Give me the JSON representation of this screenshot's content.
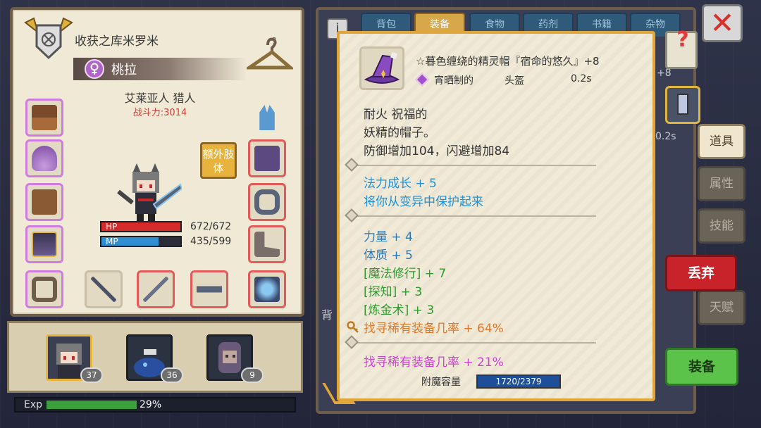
{
  "character": {
    "guild_name": "收获之库米罗米",
    "name": "桃拉",
    "race_class": "艾莱亚人 猎人",
    "combat_power": "战斗力:3014",
    "extra_limb_label": "额外肢体",
    "hp_label": "HP",
    "hp_value": "672/672",
    "mp_label": "MP",
    "mp_value": "435/599",
    "hp_fraction": 1.0,
    "mp_fraction": 0.726
  },
  "party": [
    {
      "level": "37"
    },
    {
      "level": "36"
    },
    {
      "level": "9"
    }
  ],
  "exp": {
    "label": "Exp",
    "percent_text": "29%",
    "fraction": 0.29
  },
  "inventory": {
    "info_label": "i",
    "tabs": [
      "背包",
      "装备",
      "食物",
      "药剂",
      "书籍",
      "杂物"
    ],
    "active_tab": "装备",
    "side_tabs": [
      "道具",
      "属性",
      "技能",
      "",
      "天赋"
    ],
    "discard_label": "丢弃",
    "equip_label": "装备",
    "close_glyph": "✕",
    "help_glyph": "?",
    "partial_label": "背",
    "partial_number": "+8",
    "partial_time": "0.2s"
  },
  "tooltip": {
    "title": "☆暮色缠绕的精灵帽『宿命的悠久』+8",
    "material": "宵晒制的",
    "slot": "头盔",
    "speed": "0.2s",
    "desc_line1": "耐火 祝福的",
    "desc_line2": "妖精的帽子。",
    "desc_line3": "防御增加104，闪避增加84",
    "ench1": "法力成长 + 5",
    "ench2": "将你从变异中保护起来",
    "stat1": "力量 + 4",
    "stat2": "体质 + 5",
    "stat3": "[魔法修行] + 7",
    "stat4": "[探知] + 3",
    "stat5": "[炼金术] + 3",
    "stat6": "找寻稀有装备几率 + 64%",
    "stat7": "找寻稀有装备几率 + 21%",
    "enchant_capacity_label": "附魔容量",
    "enchant_capacity_value": "1720/2379",
    "enchant_fraction": 0.723
  },
  "colors": {
    "panel_bg": "#efe9d6",
    "panel_border": "#6e5d4a",
    "gold": "#e0a63a",
    "hp": "#d62b2b",
    "mp": "#2f8fd0",
    "blue_text": "#1f8fd4",
    "green_text": "#2e9a2e",
    "orange_text": "#e0782a",
    "pink_text": "#cf3fd0"
  }
}
